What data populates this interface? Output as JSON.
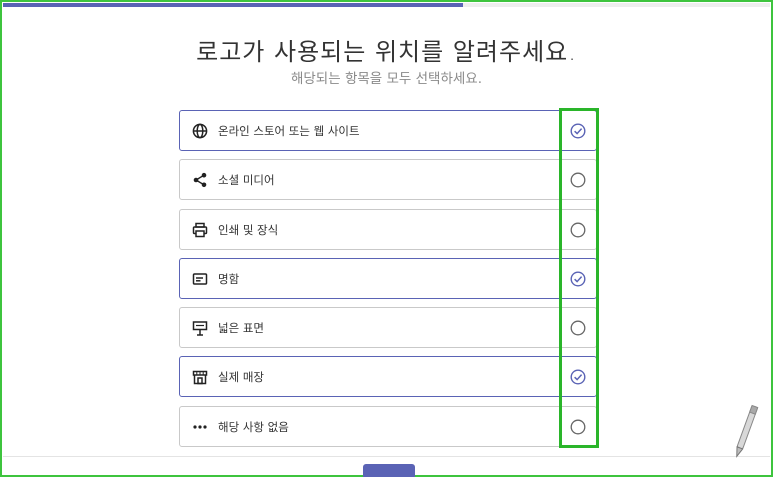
{
  "progress": {
    "value": 0.6
  },
  "header": {
    "title": "로고가 사용되는 위치를 알려주세요.",
    "subtitle": "해당되는 항목을 모두 선택하세요."
  },
  "options": [
    {
      "label": "온라인 스토어 또는 웹 사이트",
      "icon": "globe-icon",
      "selected": true
    },
    {
      "label": "소셜 미디어",
      "icon": "share-icon",
      "selected": false
    },
    {
      "label": "인쇄 및 장식",
      "icon": "printer-icon",
      "selected": false
    },
    {
      "label": "명함",
      "icon": "business-card-icon",
      "selected": true
    },
    {
      "label": "넓은 표면",
      "icon": "billboard-icon",
      "selected": false
    },
    {
      "label": "실제 매장",
      "icon": "storefront-icon",
      "selected": true
    },
    {
      "label": "해당 사항 없음",
      "icon": "more-dots-icon",
      "selected": false
    }
  ],
  "colors": {
    "accent": "#5a63b5",
    "highlight": "#2ab52a",
    "border": "#c9c9c9"
  }
}
